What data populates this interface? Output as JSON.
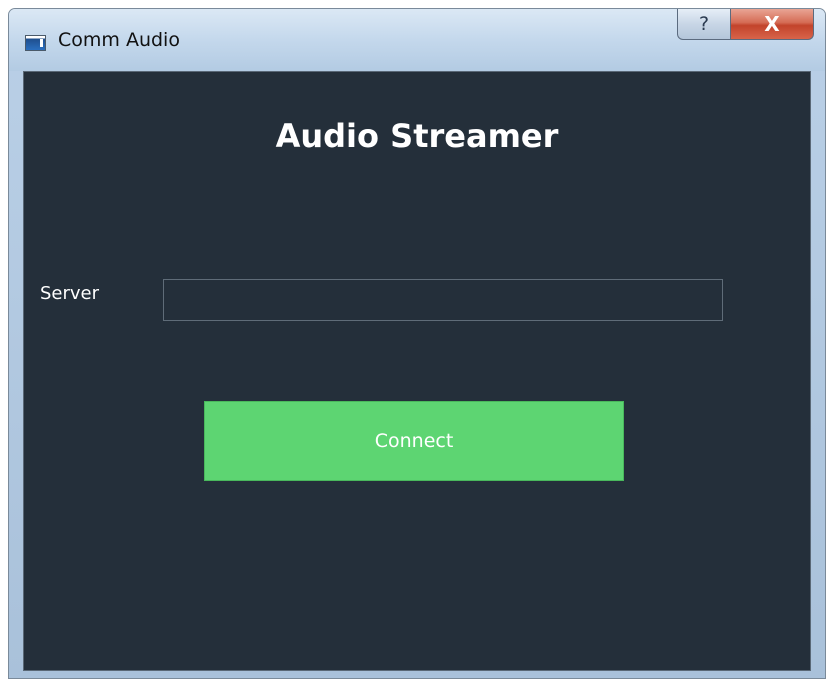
{
  "window": {
    "title": "Comm Audio",
    "help_symbol": "?",
    "close_symbol": "X"
  },
  "main": {
    "heading": "Audio Streamer",
    "server_label": "Server",
    "server_value": "",
    "connect_label": "Connect"
  },
  "colors": {
    "client_background": "#242f3a",
    "connect_button": "#5dd572",
    "close_button": "#c2432b"
  }
}
